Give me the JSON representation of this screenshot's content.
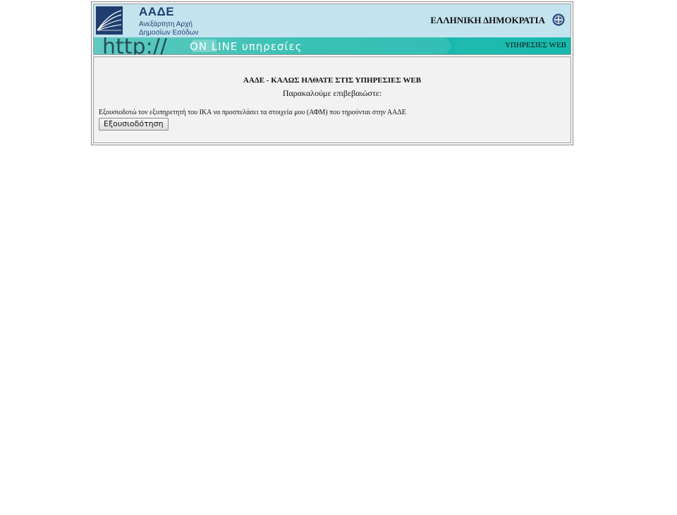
{
  "header": {
    "org_name": "ΑΑΔΕ",
    "org_subtitle_line1": "Ανεξάρτητη Αρχή",
    "org_subtitle_line2": "Δημοσίων Εσόδων",
    "republic": "ΕΛΛΗΝΙΚΗ ΔΗΜΟΚΡΑΤΙΑ",
    "logo_icon": "aade-logo-icon",
    "emblem_icon": "greek-emblem-icon"
  },
  "banner": {
    "graphic_text": "http://ON LINE υπηρεσίες",
    "services_label": "ΥΠΗΡΕΣΙΕΣ WEB"
  },
  "content": {
    "welcome": "ΑΑΔΕ - ΚΑΛΩΣ ΗΛΘΑΤΕ ΣΤΙΣ ΥΠΗΡΕΣΙΕΣ WEB",
    "confirm": "Παρακαλούμε επιβεβαιώστε:",
    "authorization_text": "Εξουσιοδοτώ τον εξυπηρετητή του ΙΚΑ να προσπελάσει τα στοιχεία μου (ΑΦΜ) που τηρούνται στην ΑΑΔΕ",
    "authorize_button": "Εξουσιοδότηση"
  },
  "colors": {
    "header_bg": "#c3e3ef",
    "banner_teal": "#17b9ad",
    "brand_navy": "#1f3e6f",
    "content_bg": "#f2f2f2"
  }
}
